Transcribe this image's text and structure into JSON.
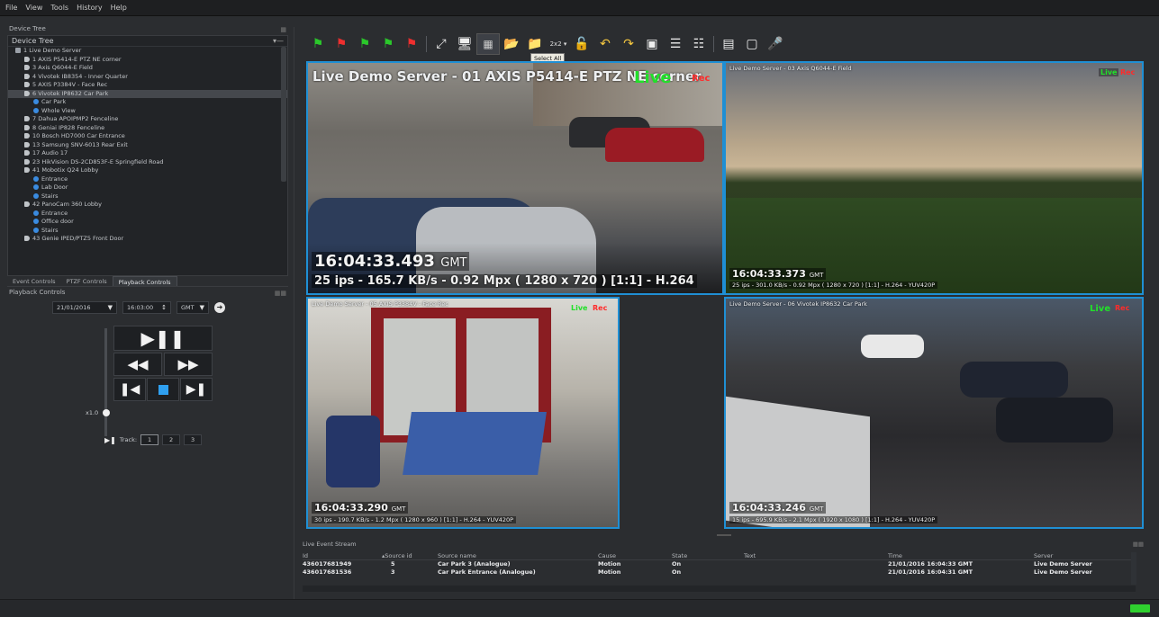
{
  "menu": [
    "File",
    "View",
    "Tools",
    "History",
    "Help"
  ],
  "left": {
    "devices_label": "Device Tree",
    "tree_header": "Device Tree",
    "tree": [
      {
        "label": "1 Live Demo Server",
        "indent": 1,
        "icon": "srv"
      },
      {
        "label": "1 AXIS P5414-E PTZ NE corner",
        "indent": 2,
        "icon": "cam"
      },
      {
        "label": "3 Axis Q6044-E Field",
        "indent": 2,
        "icon": "cam"
      },
      {
        "label": "4 Vivotek IB8354 - Inner Quarter",
        "indent": 2,
        "icon": "cam"
      },
      {
        "label": "5 AXIS P3384V - Face Rec",
        "indent": 2,
        "icon": "cam"
      },
      {
        "label": "6 Vivotek IP8632 Car Park",
        "indent": 2,
        "icon": "cam",
        "selected": true
      },
      {
        "label": "Car Park",
        "indent": 3,
        "icon": "view"
      },
      {
        "label": "Whole View",
        "indent": 3,
        "icon": "view"
      },
      {
        "label": "7 Dahua APOIPMP2 Fenceline",
        "indent": 2,
        "icon": "cam"
      },
      {
        "label": "8 Geniai IP828 Fenceline",
        "indent": 2,
        "icon": "cam"
      },
      {
        "label": "10 Bosch HD7000 Car Entrance",
        "indent": 2,
        "icon": "cam"
      },
      {
        "label": "13 Samsung SNV-6013 Rear Exit",
        "indent": 2,
        "icon": "cam"
      },
      {
        "label": "17 Audio 17",
        "indent": 2,
        "icon": "cam"
      },
      {
        "label": "23 HikVision DS-2CD853F-E Springfield Road",
        "indent": 2,
        "icon": "cam"
      },
      {
        "label": "41 Mobotix Q24 Lobby",
        "indent": 2,
        "icon": "cam"
      },
      {
        "label": "Entrance",
        "indent": 3,
        "icon": "view"
      },
      {
        "label": "Lab Door",
        "indent": 3,
        "icon": "view"
      },
      {
        "label": "Stairs",
        "indent": 3,
        "icon": "view"
      },
      {
        "label": "42 PanoCam 360 Lobby",
        "indent": 2,
        "icon": "cam"
      },
      {
        "label": "Entrance",
        "indent": 3,
        "icon": "view"
      },
      {
        "label": "Office door",
        "indent": 3,
        "icon": "view"
      },
      {
        "label": "Stairs",
        "indent": 3,
        "icon": "view"
      },
      {
        "label": "43 Genie IPED/PTZ5 Front Door",
        "indent": 2,
        "icon": "cam"
      }
    ],
    "tabs": [
      "Event Controls",
      "PTZF Controls",
      "Playback Controls"
    ],
    "active_tab": 2,
    "playback_title": "Playback Controls",
    "date": "21/01/2016",
    "time": "16:03:00",
    "tz": "GMT",
    "speed": "x1.0",
    "tracks_label": "Track:",
    "tracks": [
      "1",
      "2",
      "3"
    ]
  },
  "toolbar": {
    "tooltip": "Select All",
    "layout": "2x2"
  },
  "videos": [
    {
      "title": "Live Demo Server - 01 AXIS P5414-E PTZ NE corner",
      "live": "Live",
      "rec": "Rec",
      "time": "16:04:33.493",
      "tz": "GMT",
      "stats": "25 ips  -  165.7 KB/s  -  0.92 Mpx  ( 1280 x 720 ) [1:1] -  H.264"
    },
    {
      "title": "Live Demo Server - 03 Axis Q6044-E Field",
      "live": "Live",
      "rec": "Rec",
      "time": "16:04:33.373",
      "tz": "GMT",
      "stats": "25 ips  -  301.0 KB/s  -  0.92 Mpx  ( 1280 x 720 ) [1:1] -  H.264  -  YUV420P"
    },
    {
      "title": "Live Demo Server - 05 AXIS P3384V - Face Rec",
      "live": "Live",
      "rec": "Rec",
      "time": "16:04:33.290",
      "tz": "GMT",
      "stats": "30 ips  -  190.7 KB/s  -  1.2 Mpx  ( 1280 x 960 ) [1:1] -  H.264  -  YUV420P"
    },
    {
      "title": "Live Demo Server - 06 Vivotek IP8632 Car Park",
      "live": "Live",
      "rec": "Rec",
      "time": "16:04:33.246",
      "tz": "GMT",
      "stats": "15 ips  -  695.9 KB/s  -  2.1 Mpx  ( 1920 x 1080 ) [1:1] -  H.264  -  YUV420P"
    }
  ],
  "events": {
    "title": "Live Event Stream",
    "columns": [
      "Id",
      "Source id",
      "Source name",
      "Cause",
      "State",
      "Text",
      "Time",
      "Server"
    ],
    "rows": [
      [
        "436017681949",
        "5",
        "Car Park 3 (Analogue)",
        "Motion",
        "On",
        "",
        "21/01/2016 16:04:33 GMT",
        "Live Demo Server"
      ],
      [
        "436017681536",
        "3",
        "Car Park Entrance (Analogue)",
        "Motion",
        "On",
        "",
        "21/01/2016 16:04:31 GMT",
        "Live Demo Server"
      ]
    ]
  },
  "colors": {
    "accent": "#1f8fd4",
    "live": "#22e02a",
    "rec": "#ff2b2b",
    "status": "#2fd02f"
  }
}
